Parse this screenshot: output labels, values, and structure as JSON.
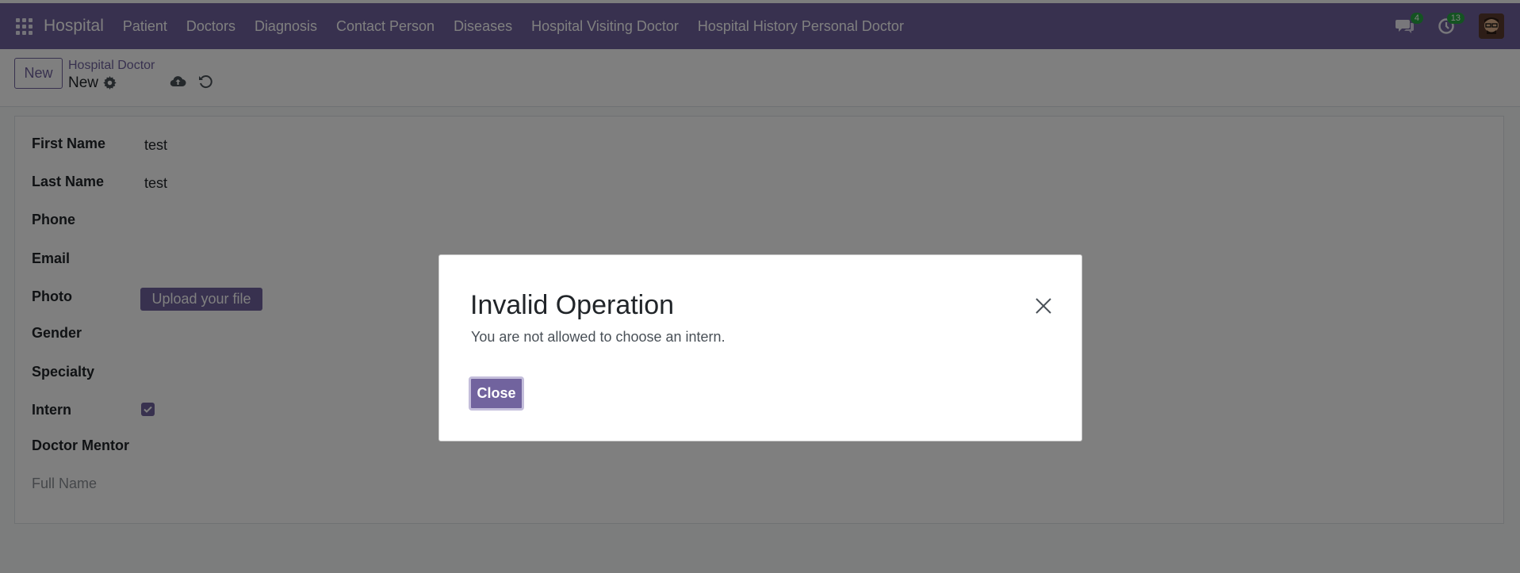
{
  "topbar": {
    "app_name": "Hospital",
    "nav": [
      "Patient",
      "Doctors",
      "Diagnosis",
      "Contact Person",
      "Diseases",
      "Hospital Visiting Doctor",
      "Hospital History Personal Doctor"
    ],
    "messages_count": "4",
    "activities_count": "13",
    "icons": {
      "apps": "apps-grid-icon",
      "messages": "chat-icon",
      "activities": "clock-icon"
    }
  },
  "control_panel": {
    "new_button": "New",
    "breadcrumb_parent": "Hospital Doctor",
    "breadcrumb_current": "New",
    "icons": {
      "settings": "gear-icon",
      "save": "cloud-upload-icon",
      "discard": "undo-icon"
    }
  },
  "form": {
    "fields": [
      {
        "label": "First Name",
        "value": "test"
      },
      {
        "label": "Last Name",
        "value": "test"
      },
      {
        "label": "Phone",
        "value": ""
      },
      {
        "label": "Email",
        "value": ""
      },
      {
        "label": "Photo",
        "value": ""
      },
      {
        "label": "Gender",
        "value": ""
      },
      {
        "label": "Specialty",
        "value": ""
      },
      {
        "label": "Intern",
        "value": ""
      },
      {
        "label": "Doctor Mentor",
        "value": ""
      }
    ],
    "upload_label": "Upload your file",
    "intern_checked": true,
    "full_name_placeholder": "Full Name"
  },
  "dialog": {
    "title": "Invalid Operation",
    "message": "You are not allowed to choose an intern.",
    "close_button": "Close"
  },
  "colors": {
    "brand": "#71639e",
    "badge": "#28a745"
  }
}
